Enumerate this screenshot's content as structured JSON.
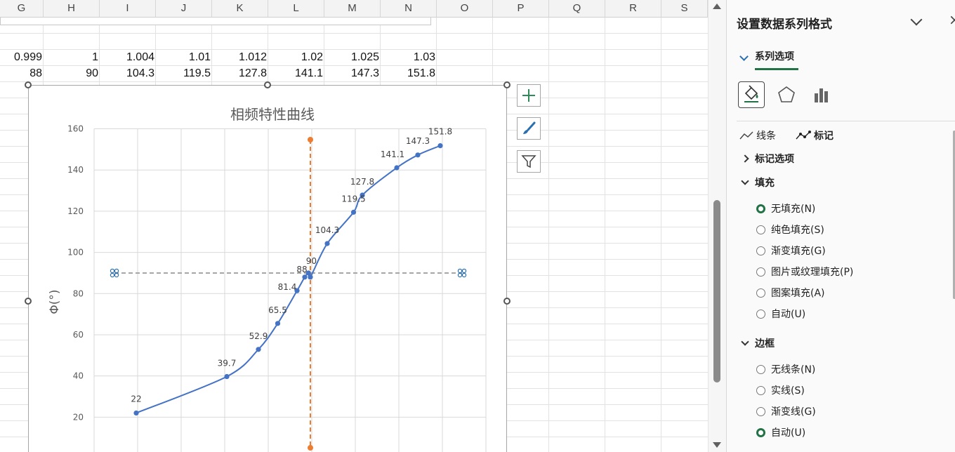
{
  "sheet": {
    "columns": [
      "G",
      "H",
      "I",
      "J",
      "K",
      "L",
      "M",
      "N",
      "O",
      "P",
      "Q",
      "R",
      "S"
    ],
    "rows": [
      [
        "0.999",
        "1",
        "1.004",
        "1.01",
        "1.012",
        "1.02",
        "1.025",
        "1.03"
      ],
      [
        "88",
        "90",
        "104.3",
        "119.5",
        "127.8",
        "141.1",
        "147.3",
        "151.8"
      ]
    ]
  },
  "chart_data": {
    "type": "scatter",
    "title": "相频特性曲线",
    "ylabel": "Φ(°)",
    "xlabel": "",
    "ylim": [
      0,
      160
    ],
    "yticks": [
      20,
      40,
      60,
      80,
      100,
      120,
      140,
      160
    ],
    "grid": true,
    "series": [
      {
        "x": [
          0.9,
          0.97,
          0.985,
          0.99,
          0.995,
          0.997,
          0.999,
          1,
          1.004,
          1.01,
          1.012,
          1.02,
          1.025,
          1.03
        ],
        "y": [
          22,
          39.7,
          52.9,
          65.5,
          81.4,
          88,
          90,
          88,
          104.3,
          119.5,
          127.8,
          141.1,
          147.3,
          151.8
        ],
        "labels": [
          "22",
          "39.7",
          "52.9",
          "65.5",
          "81.4",
          "",
          "90",
          "88",
          "104.3",
          "119.5",
          "127.8",
          "141.1",
          "147.3",
          "151.8"
        ],
        "color": "#4472c4"
      }
    ],
    "reference_lines": {
      "vertical_x": 1,
      "horizontal_y": 90,
      "vertical_color": "#ed7d31",
      "horizontal_color": "#a6a6a6"
    }
  },
  "chart_tools": {
    "add_icon": "plus-icon",
    "style_icon": "brush-icon",
    "filter_icon": "funnel-icon"
  },
  "pane": {
    "title": "设置数据系列格式",
    "series_options_tab": "系列选项",
    "subtabs": [
      "线条",
      "标记"
    ],
    "marker_options": "标记选项",
    "fill": {
      "heading": "填充",
      "options": [
        "无填充(N)",
        "纯色填充(S)",
        "渐变填充(G)",
        "图片或纹理填充(P)",
        "图案填充(A)",
        "自动(U)"
      ],
      "selected": 0
    },
    "border": {
      "heading": "边框",
      "options": [
        "无线条(N)",
        "实线(S)",
        "渐变线(G)",
        "自动(U)"
      ],
      "selected": 3
    },
    "accent_color": "#217346"
  }
}
